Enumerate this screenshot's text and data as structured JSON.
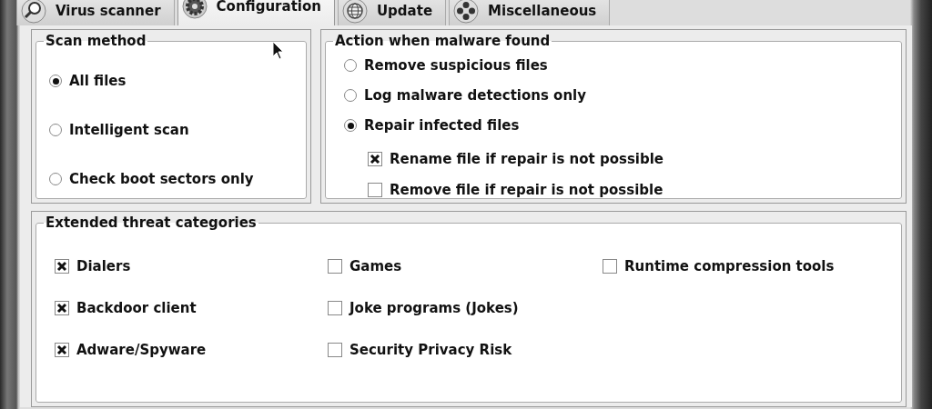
{
  "tabs": [
    {
      "label": "Virus scanner",
      "kind": "search",
      "selected": false
    },
    {
      "label": "Configuration",
      "kind": "gear",
      "selected": true
    },
    {
      "label": "Update",
      "kind": "globe",
      "selected": false
    },
    {
      "label": "Miscellaneous",
      "kind": "misc",
      "selected": false
    }
  ],
  "scan_method": {
    "title": "Scan method",
    "options": [
      {
        "label": "All files",
        "selected": true
      },
      {
        "label": "Intelligent scan",
        "selected": false
      },
      {
        "label": "Check boot sectors only",
        "selected": false
      }
    ]
  },
  "malware_action": {
    "title": "Action when malware found",
    "options": [
      {
        "label": "Remove suspicious files",
        "selected": false
      },
      {
        "label": "Log malware detections only",
        "selected": false
      },
      {
        "label": "Repair infected files",
        "selected": true,
        "children": [
          {
            "label": "Rename file if repair is not possible",
            "checked": true
          },
          {
            "label": "Remove file if repair is not possible",
            "checked": false
          }
        ]
      }
    ]
  },
  "threat_categories": {
    "title": "Extended threat categories",
    "columns": [
      [
        {
          "label": "Dialers",
          "checked": true
        },
        {
          "label": "Backdoor client",
          "checked": true
        },
        {
          "label": "Adware/Spyware",
          "checked": true
        }
      ],
      [
        {
          "label": "Games",
          "checked": false
        },
        {
          "label": "Joke programs (Jokes)",
          "checked": false
        },
        {
          "label": "Security Privacy Risk",
          "checked": false
        }
      ],
      [
        {
          "label": "Runtime compression tools",
          "checked": false
        }
      ]
    ]
  }
}
